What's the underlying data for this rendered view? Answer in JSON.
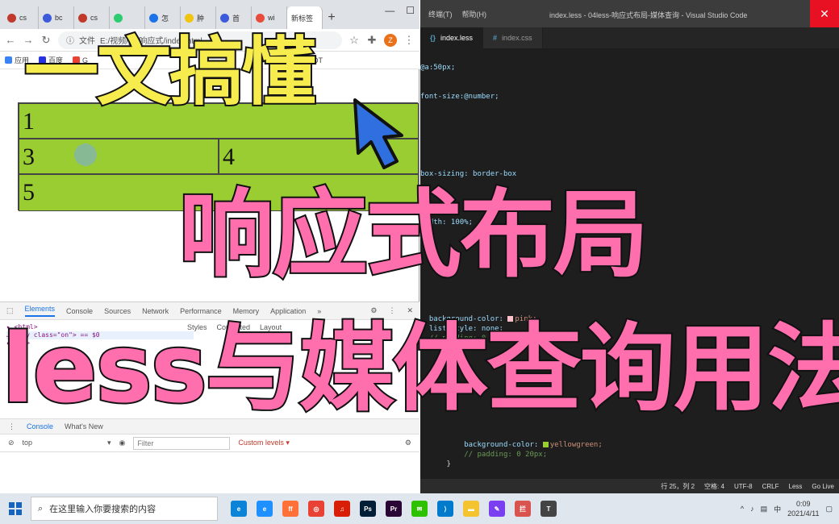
{
  "browser": {
    "tabs": [
      {
        "label": "cs",
        "color": "#c0392b"
      },
      {
        "label": "bc",
        "color": "#3b5bdb"
      },
      {
        "label": "cs",
        "color": "#c0392b"
      },
      {
        "label": "",
        "color": "#2ecc71"
      },
      {
        "label": "怎",
        "color": "#1a73e8"
      },
      {
        "label": "肿",
        "color": "#f1c40f"
      },
      {
        "label": "首",
        "color": "#3b5bdb"
      },
      {
        "label": "wi",
        "color": "#e74c3c"
      },
      {
        "label": "新标签",
        "color": ""
      }
    ],
    "url": "E:/视频/pc/响应式/index.html",
    "url_prefix": "文件",
    "profile_initial": "Z",
    "bookmarks": [
      "应用",
      "百度",
      "G",
      "ODT"
    ],
    "page_grid": [
      "1",
      "",
      "3",
      "4",
      "5"
    ],
    "devtools": {
      "tabs": [
        "Elements",
        "Console",
        "Sources",
        "Network",
        "Performance",
        "Memory",
        "Application",
        "»"
      ],
      "code_lines": [
        "▸ <html>",
        "…<body class=\"on\"> == $0",
        "  ▸ <ul>"
      ],
      "styles_tabs": [
        "Styles",
        "Computed",
        "Layout"
      ],
      "drawer_tabs": [
        "Console",
        "What's New"
      ],
      "context": "top",
      "filter_placeholder": "Filter",
      "levels": "Custom levels ▾"
    }
  },
  "vscode": {
    "menu": [
      "终端(T)",
      "帮助(H)"
    ],
    "title": "index.less - 04less-响应式布局-媒体查询 - Visual Studio Code",
    "tabs": [
      "index.less",
      "index.css"
    ],
    "code": {
      "l1": "@a:50px;",
      "l2": "font-size:@number;",
      "l3": "box-sizing: border-box",
      "l4": "width: 100%;",
      "l5a": "background-color: ",
      "l5b": "pink;",
      "l6": "list-style: none;",
      "l7": "// padding: 0 20px;",
      "l8a": "background-color: ",
      "l8b": "yellowgreen;",
      "l9": "// padding: 0 20px;",
      "l10": "}"
    },
    "status": [
      "行 25，列 2",
      "空格: 4",
      "UTF-8",
      "CRLF",
      "Less",
      "Go Live"
    ]
  },
  "overlay": {
    "line1": "一文搞懂",
    "line2": "响应式布局",
    "line3": "less与媒体查询用法"
  },
  "taskbar": {
    "search_placeholder": "在这里输入你要搜索的内容",
    "apps": [
      {
        "name": "edge",
        "color": "#0b84d8",
        "label": "e"
      },
      {
        "name": "ie",
        "color": "#1e90ff",
        "label": "e"
      },
      {
        "name": "firefox",
        "color": "#ff7139",
        "label": "ff"
      },
      {
        "name": "chrome",
        "color": "#e94235",
        "label": "◎"
      },
      {
        "name": "netease",
        "color": "#d81e06",
        "label": "♫"
      },
      {
        "name": "photoshop",
        "color": "#001e36",
        "label": "Ps"
      },
      {
        "name": "premiere",
        "color": "#2a0634",
        "label": "Pr"
      },
      {
        "name": "wechat",
        "color": "#2dc100",
        "label": "✉"
      },
      {
        "name": "vscode",
        "color": "#007acc",
        "label": "⟩"
      },
      {
        "name": "explorer",
        "color": "#f4c430",
        "label": "▬"
      },
      {
        "name": "notes",
        "color": "#7b3ff2",
        "label": "✎"
      },
      {
        "name": "ban",
        "color": "#d9534f",
        "label": "拦"
      },
      {
        "name": "capture",
        "color": "#444444",
        "label": "T"
      }
    ],
    "tray": [
      "^",
      "♪",
      "▤",
      "中"
    ],
    "time": "0:09",
    "date": "2021/4/11"
  }
}
